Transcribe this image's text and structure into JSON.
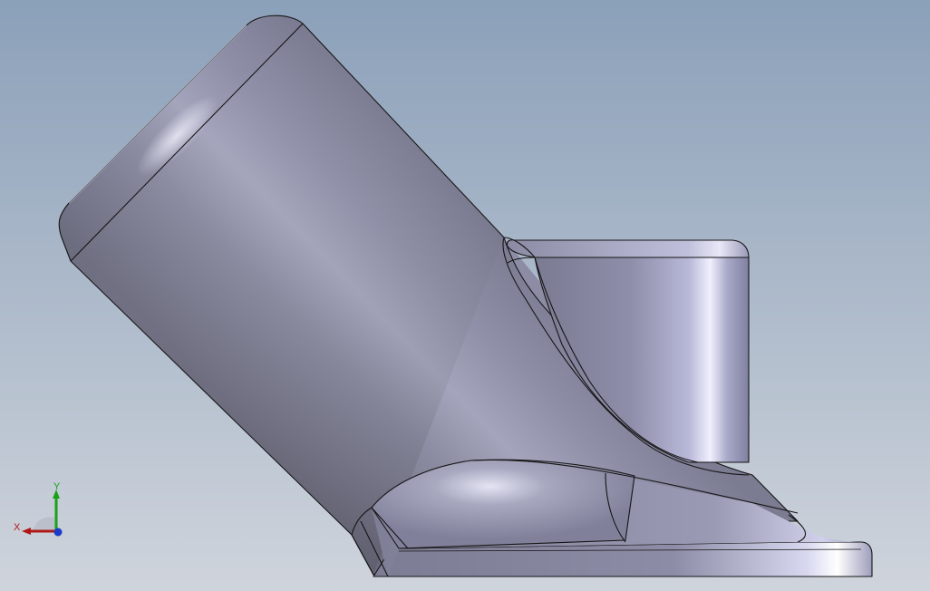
{
  "viewport": {
    "background_top": "#8da0b8",
    "background_bottom": "#c9d0da",
    "part_color": "#8e8ea6",
    "edge_color": "#1a1a1a"
  },
  "triad": {
    "x_label": "X",
    "y_label": "Y",
    "x_color": "#b01818",
    "y_color": "#1aa01a",
    "z_color": "#1a3cc8"
  }
}
